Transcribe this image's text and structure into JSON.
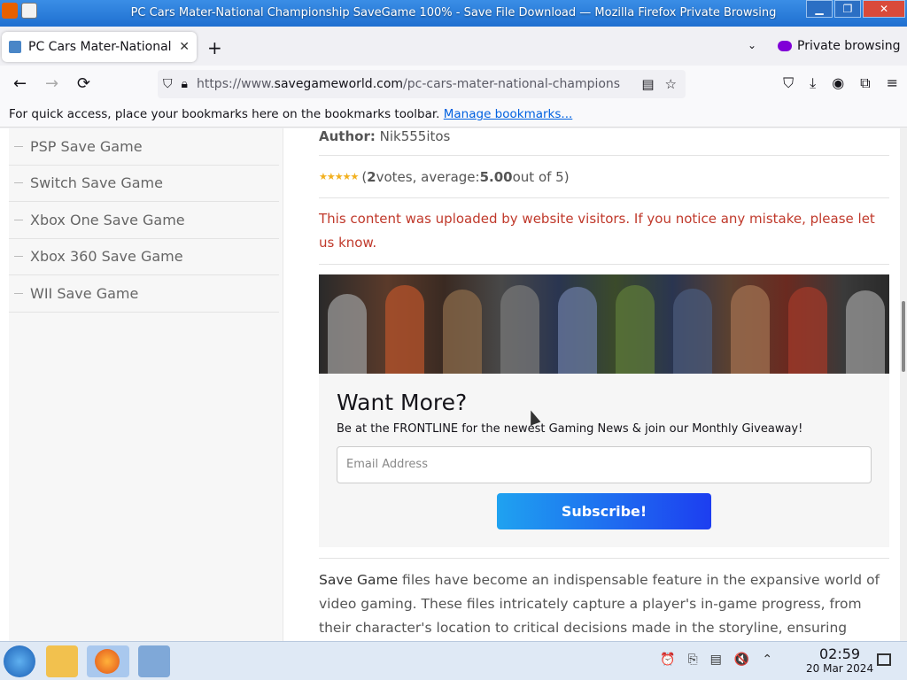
{
  "window": {
    "title": "PC Cars Mater-National Championship SaveGame 100% - Save File Download — Mozilla Firefox Private Browsing",
    "buttons": {
      "minimize": "▁",
      "maximize": "❐",
      "close": "✕"
    }
  },
  "tabs": [
    {
      "label": "PC Cars Mater-National C",
      "close": "✕"
    }
  ],
  "tabstrip": {
    "new_tab": "+",
    "list_all": "⌄",
    "private_label": "Private browsing"
  },
  "navbar": {
    "back": "←",
    "forward": "→",
    "reload": "⟳",
    "url_prefix": "https://www.",
    "url_host": "savegameworld.com",
    "url_path": "/pc-cars-mater-national-champions",
    "reader_icon": "▤",
    "bookmark_icon": "☆",
    "right_icons": [
      "⛉",
      "⤓",
      "◉",
      "⧉",
      "≡"
    ]
  },
  "bookmarks_bar": {
    "text": "For quick access, place your bookmarks here on the bookmarks toolbar.",
    "link": "Manage bookmarks..."
  },
  "sidebar": {
    "items": [
      "PSP Save Game",
      "Switch Save Game",
      "Xbox One Save Game",
      "Xbox 360 Save Game",
      "WII Save Game"
    ]
  },
  "content": {
    "author_label": "Author:",
    "author_name": "Nik555itos",
    "rating": {
      "stars": "★★★★★",
      "open": "(",
      "votes": "2",
      "votes_text": " votes, average: ",
      "average": "5.00",
      "out_of": " out of 5)",
      "value": 5.0,
      "max": 5
    },
    "notice": "This content was uploaded by website visitors. If you notice any mistake, please let us know.",
    "promo": {
      "heading": "Want More?",
      "subheading": "Be at the FRONTLINE for the newest Gaming News & join our Monthly Giveaway!",
      "email_placeholder": "Email Address",
      "button": "Subscribe!"
    },
    "body_highlight": "Save Game",
    "body_text": " files have become an indispensable feature in the expansive world of video gaming. These files intricately capture a player's in-game progress, from their character's location to critical decisions made in the storyline, ensuring seamless"
  },
  "taskbar": {
    "time": "02:59",
    "date": "20 Mar 2024",
    "tray_icons": [
      "⏰",
      "⎘",
      "▤",
      "🔇",
      "⌃"
    ]
  },
  "colors": {
    "accent": "#0061e0",
    "notice": "#c0392b",
    "star": "#f2b01e",
    "subscribe_start": "#1fa2f0",
    "subscribe_end": "#1d3ef0",
    "private": "#8000d7"
  }
}
